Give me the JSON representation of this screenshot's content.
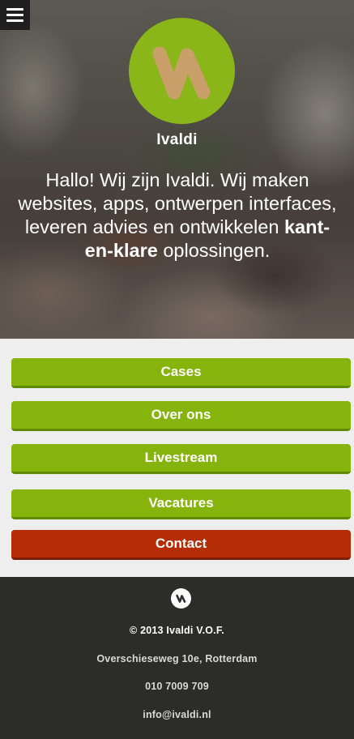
{
  "header": {
    "menu_icon": "hamburger-menu-icon",
    "logo_icon": "ivaldi-logo-icon",
    "brand_name": "Ivaldi",
    "tagline_start": "Hallo! Wij zijn Ivaldi. Wij maken websites, apps, ontwerpen interfaces, leveren advies en ontwikkelen ",
    "tagline_bold": "kant-en-klare",
    "tagline_end": " oplossingen.",
    "brand_green": "#8ab61a"
  },
  "nav": {
    "items": [
      {
        "label": "Cases",
        "color": "#86b40c"
      },
      {
        "label": "Over ons",
        "color": "#86b40c"
      },
      {
        "label": "Livestream",
        "color": "#86b40c"
      },
      {
        "label": "Vacatures",
        "color": "#86b40c"
      },
      {
        "label": "Contact",
        "color": "#b42d06"
      }
    ]
  },
  "footer": {
    "logo_icon": "ivaldi-small-logo-icon",
    "copyright": "© 2013 Ivaldi V.O.F.",
    "address": "Overschieseweg 10e, Rotterdam",
    "phone": "010 7009 709",
    "email": "info@ivaldi.nl",
    "background": "#2c2c28"
  }
}
